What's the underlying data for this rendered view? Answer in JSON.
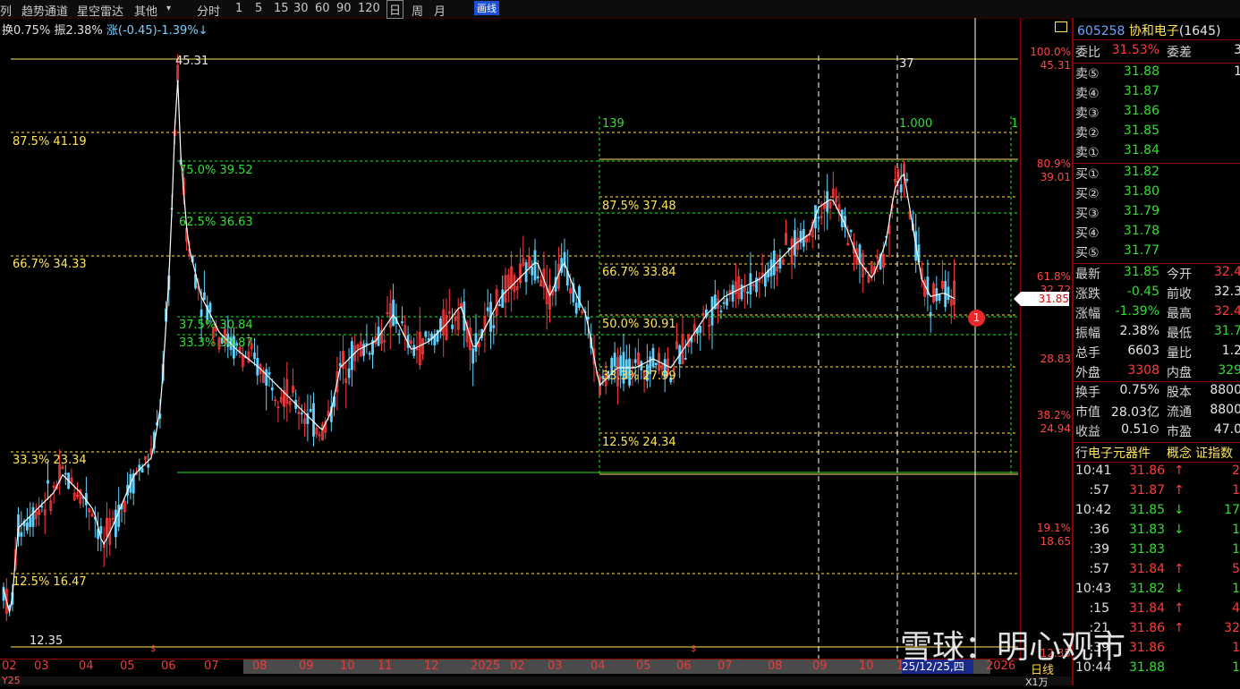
{
  "toolbar": {
    "items": [
      "列",
      "趋势通道",
      "星空雷达",
      "其他",
      "分时",
      "1",
      "5",
      "15",
      "30",
      "60",
      "90",
      "120",
      "日",
      "周",
      "月"
    ],
    "other_arrow": "▾",
    "draw_label": "画线"
  },
  "info": {
    "turnover": "换0.75%",
    "amplitude": "振2.38%",
    "change": "涨(-0.45)-1.39%↓"
  },
  "colors": {
    "fib_yellow": "#ffe55a",
    "fib_green": "#33dd33",
    "up": "#ff3b3b",
    "down": "#33dd33",
    "ma": "#ffffff",
    "axis_border": "#8b0000"
  },
  "chart_data": {
    "type": "candlestick",
    "high_label": "45.31",
    "low_label": "12.35",
    "right_top_label": "37",
    "fib_left": [
      {
        "label": "87.5% 41.19"
      },
      {
        "label": "66.7% 34.33"
      },
      {
        "label": "33.3% 23.34"
      },
      {
        "label": "12.5% 16.47"
      }
    ],
    "fib_mid": [
      {
        "label": "75.0% 39.52"
      },
      {
        "label": "62.5% 36.63"
      },
      {
        "label": "37.5% 30.84"
      },
      {
        "label": "33.3% 30.87"
      }
    ],
    "fib_right": [
      {
        "label": "87.5% 37.48"
      },
      {
        "label": "66.7% 33.84"
      },
      {
        "label": "50.0% 30.91"
      },
      {
        "label": "33.3% 27.99"
      },
      {
        "label": "12.5% 24.34"
      }
    ],
    "marker_139": "139",
    "marker_1000": "1.000",
    "marker_1": "1",
    "y_axis": [
      {
        "pct": "100.0%",
        "price": "45.31"
      },
      {
        "pct": "80.9%",
        "price": "39.01"
      },
      {
        "pct": "61.8%",
        "price": "32.72"
      },
      {
        "pct": "",
        "price": "28.83"
      },
      {
        "pct": "38.2%",
        "price": "24.94"
      },
      {
        "pct": "19.1%",
        "price": "18.65"
      },
      {
        "pct": "",
        "price": "12.35"
      }
    ],
    "current_price": "31.85",
    "x_labels": [
      "02",
      "03",
      "04",
      "05",
      "06",
      "07",
      "08",
      "09",
      "10",
      "11",
      "12",
      "2025",
      "02",
      "03",
      "04",
      "05",
      "06",
      "07",
      "08",
      "09",
      "10",
      "1",
      "2026"
    ],
    "x_highlight": "25/12/25,四",
    "period_label": "日线",
    "bottom_left": "Y25",
    "bottom_right": "X1万",
    "alert_number": "1",
    "ylim": [
      12.35,
      45.31
    ]
  },
  "panel": {
    "code": "605258",
    "name": "协和电子",
    "extra": "(1645)",
    "weibi": {
      "label": "委比",
      "value": "31.53%",
      "label2": "委差",
      "value2": "3"
    },
    "sells": [
      {
        "label": "卖⑤",
        "price": "31.88",
        "vol": "1"
      },
      {
        "label": "卖④",
        "price": "31.87",
        "vol": ""
      },
      {
        "label": "卖③",
        "price": "31.86",
        "vol": ""
      },
      {
        "label": "卖②",
        "price": "31.85",
        "vol": ""
      },
      {
        "label": "卖①",
        "price": "31.84",
        "vol": ""
      }
    ],
    "buys": [
      {
        "label": "买①",
        "price": "31.82",
        "vol": ""
      },
      {
        "label": "买②",
        "price": "31.80",
        "vol": ""
      },
      {
        "label": "买③",
        "price": "31.79",
        "vol": ""
      },
      {
        "label": "买④",
        "price": "31.78",
        "vol": ""
      },
      {
        "label": "买⑤",
        "price": "31.77",
        "vol": ""
      }
    ],
    "quote": [
      {
        "l1": "最新",
        "v1": "31.85",
        "c1": "green",
        "l2": "今开",
        "v2": "32.4",
        "c2": "red"
      },
      {
        "l1": "涨跌",
        "v1": "-0.45",
        "c1": "green",
        "l2": "前收",
        "v2": "32.3",
        "c2": "white"
      },
      {
        "l1": "涨幅",
        "v1": "-1.39%",
        "c1": "green",
        "l2": "最高",
        "v2": "32.4",
        "c2": "red"
      },
      {
        "l1": "振幅",
        "v1": "2.38%",
        "c1": "white",
        "l2": "最低",
        "v2": "31.7",
        "c2": "green"
      },
      {
        "l1": "总手",
        "v1": "6603",
        "c1": "white",
        "l2": "量比",
        "v2": "1.2",
        "c2": "white"
      },
      {
        "l1": "外盘",
        "v1": "3308",
        "c1": "red",
        "l2": "内盘",
        "v2": "329",
        "c2": "green"
      }
    ],
    "stats": [
      {
        "l1": "换手",
        "v1": "0.75%",
        "c1": "white",
        "l2": "股本",
        "v2": "8800",
        "c2": "white"
      },
      {
        "l1": "市值",
        "v1": "28.03亿",
        "c1": "white",
        "l2": "流通",
        "v2": "8800",
        "c2": "white"
      },
      {
        "l1": "收益",
        "v1": "0.51⊙",
        "c1": "white",
        "l2": "市盈",
        "v2": "47.0",
        "c2": "white"
      }
    ],
    "industry": {
      "l1": "行",
      "v1": "电子元器件",
      "l2": "概念",
      "v2": "证指数"
    },
    "ticks": [
      {
        "t": "10:41",
        "p": "31.86",
        "a": "↑",
        "c": "red",
        "v": "2"
      },
      {
        "t": ":57",
        "p": "31.87",
        "a": "↑",
        "c": "red",
        "v": "1"
      },
      {
        "t": "10:42",
        "p": "31.85",
        "a": "↓",
        "c": "green",
        "v": "17"
      },
      {
        "t": ":36",
        "p": "31.83",
        "a": "↓",
        "c": "green",
        "v": "1"
      },
      {
        "t": ":39",
        "p": "31.83",
        "a": "",
        "c": "green",
        "v": "1"
      },
      {
        "t": ":57",
        "p": "31.84",
        "a": "↑",
        "c": "red",
        "v": "5"
      },
      {
        "t": "10:43",
        "p": "31.82",
        "a": "↓",
        "c": "green",
        "v": "1"
      },
      {
        "t": ":15",
        "p": "31.84",
        "a": "↑",
        "c": "red",
        "v": "4"
      },
      {
        "t": ":21",
        "p": "31.86",
        "a": "↑",
        "c": "red",
        "v": "32"
      },
      {
        "t": ":39",
        "p": "31.86",
        "a": "",
        "c": "red",
        "v": "1"
      },
      {
        "t": "10:44",
        "p": "31.88",
        "a": "",
        "c": "green",
        "v": "1"
      }
    ]
  },
  "watermark": "雪球：明心观市"
}
